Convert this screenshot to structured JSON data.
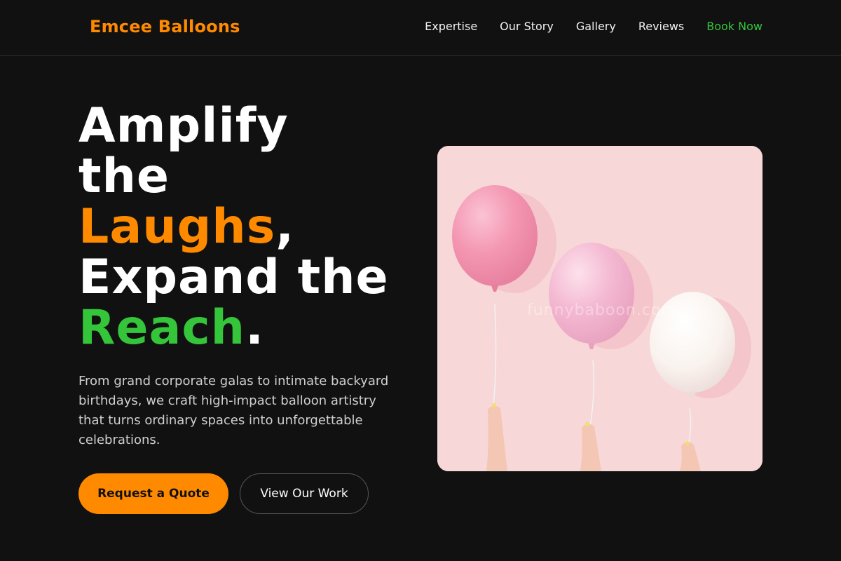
{
  "brand": {
    "name": "Emcee Balloons",
    "accent": "#ff8a00",
    "highlight": "#35c53a"
  },
  "nav": {
    "items": [
      "Expertise",
      "Our Story",
      "Gallery",
      "Reviews"
    ],
    "cta": "Book Now"
  },
  "hero": {
    "line1": "Amplify",
    "line2": "the",
    "line3_highlight": "Laughs",
    "line3_suffix": ",",
    "line4": "Expand the",
    "line5_highlight": "Reach",
    "line5_suffix": ".",
    "description": "From grand corporate galas to intimate backyard birthdays, we craft high-impact balloon artistry that turns ordinary spaces into unforgettable celebrations.",
    "primary_button": "Request a Quote",
    "secondary_button": "View Our Work"
  },
  "image": {
    "watermark": "funnybaboon.com",
    "balloon_colors": [
      "#f497b3",
      "#f4b9d2",
      "#faf3ef"
    ]
  }
}
